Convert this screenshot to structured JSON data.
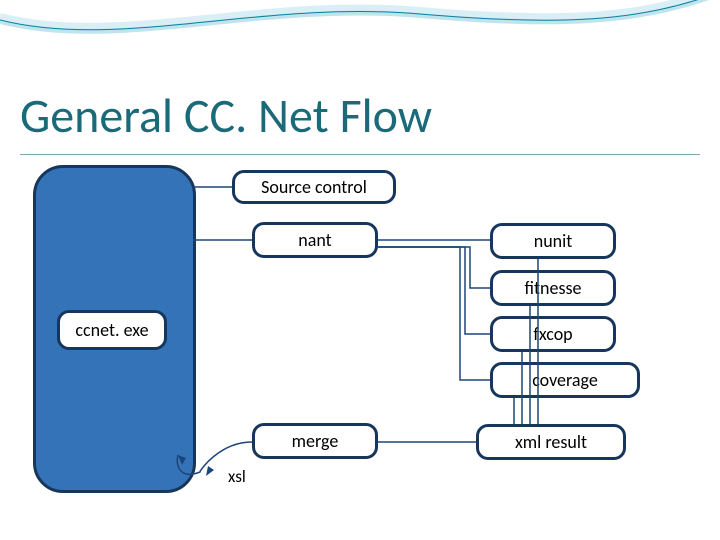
{
  "title": "General CC. Net Flow",
  "nodes": {
    "ccnet": "ccnet. exe",
    "source_control": "Source control",
    "nant": "nant",
    "nunit": "nunit",
    "fitnesse": "fitnesse",
    "fxcop": "fxcop",
    "coverage": "coverage",
    "merge": "merge",
    "xml_result": "xml result",
    "xsl": "xsl"
  },
  "flow": {
    "description": "ccnet.exe drives source control and nant; nant drives nunit, fitnesse, fxcop, coverage; their xml results are merged (with xsl) back into ccnet.exe",
    "edges": [
      [
        "ccnet.exe",
        "Source control"
      ],
      [
        "ccnet.exe",
        "nant"
      ],
      [
        "nant",
        "nunit"
      ],
      [
        "nant",
        "fitnesse"
      ],
      [
        "nant",
        "fxcop"
      ],
      [
        "nant",
        "coverage"
      ],
      [
        "nunit",
        "xml result"
      ],
      [
        "fitnesse",
        "xml result"
      ],
      [
        "fxcop",
        "xml result"
      ],
      [
        "coverage",
        "xml result"
      ],
      [
        "xml result",
        "merge"
      ],
      [
        "merge+xsl",
        "ccnet.exe"
      ]
    ]
  }
}
